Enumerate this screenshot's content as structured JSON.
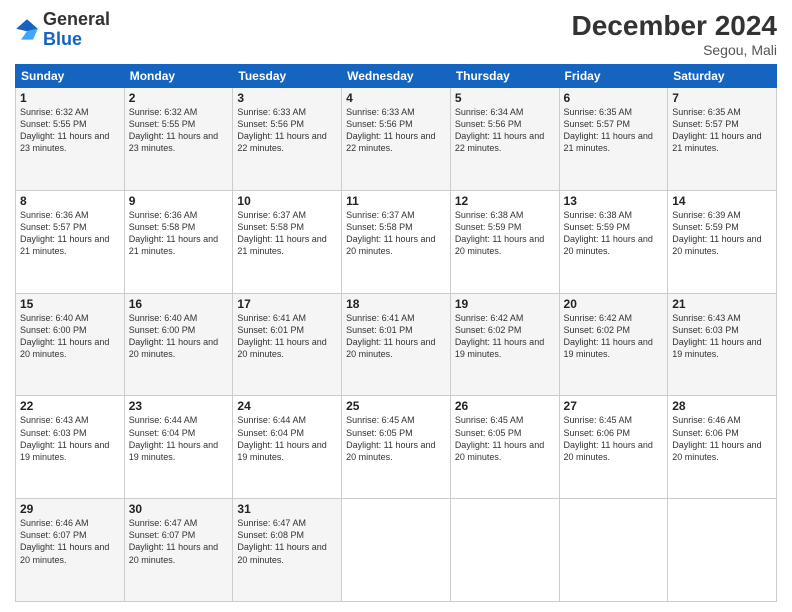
{
  "logo": {
    "text_general": "General",
    "text_blue": "Blue"
  },
  "header": {
    "month": "December 2024",
    "location": "Segou, Mali"
  },
  "weekdays": [
    "Sunday",
    "Monday",
    "Tuesday",
    "Wednesday",
    "Thursday",
    "Friday",
    "Saturday"
  ],
  "weeks": [
    [
      {
        "day": "1",
        "sunrise": "6:32 AM",
        "sunset": "5:55 PM",
        "daylight": "11 hours and 23 minutes."
      },
      {
        "day": "2",
        "sunrise": "6:32 AM",
        "sunset": "5:55 PM",
        "daylight": "11 hours and 23 minutes."
      },
      {
        "day": "3",
        "sunrise": "6:33 AM",
        "sunset": "5:56 PM",
        "daylight": "11 hours and 22 minutes."
      },
      {
        "day": "4",
        "sunrise": "6:33 AM",
        "sunset": "5:56 PM",
        "daylight": "11 hours and 22 minutes."
      },
      {
        "day": "5",
        "sunrise": "6:34 AM",
        "sunset": "5:56 PM",
        "daylight": "11 hours and 22 minutes."
      },
      {
        "day": "6",
        "sunrise": "6:35 AM",
        "sunset": "5:57 PM",
        "daylight": "11 hours and 21 minutes."
      },
      {
        "day": "7",
        "sunrise": "6:35 AM",
        "sunset": "5:57 PM",
        "daylight": "11 hours and 21 minutes."
      }
    ],
    [
      {
        "day": "8",
        "sunrise": "6:36 AM",
        "sunset": "5:57 PM",
        "daylight": "11 hours and 21 minutes."
      },
      {
        "day": "9",
        "sunrise": "6:36 AM",
        "sunset": "5:58 PM",
        "daylight": "11 hours and 21 minutes."
      },
      {
        "day": "10",
        "sunrise": "6:37 AM",
        "sunset": "5:58 PM",
        "daylight": "11 hours and 21 minutes."
      },
      {
        "day": "11",
        "sunrise": "6:37 AM",
        "sunset": "5:58 PM",
        "daylight": "11 hours and 20 minutes."
      },
      {
        "day": "12",
        "sunrise": "6:38 AM",
        "sunset": "5:59 PM",
        "daylight": "11 hours and 20 minutes."
      },
      {
        "day": "13",
        "sunrise": "6:38 AM",
        "sunset": "5:59 PM",
        "daylight": "11 hours and 20 minutes."
      },
      {
        "day": "14",
        "sunrise": "6:39 AM",
        "sunset": "5:59 PM",
        "daylight": "11 hours and 20 minutes."
      }
    ],
    [
      {
        "day": "15",
        "sunrise": "6:40 AM",
        "sunset": "6:00 PM",
        "daylight": "11 hours and 20 minutes."
      },
      {
        "day": "16",
        "sunrise": "6:40 AM",
        "sunset": "6:00 PM",
        "daylight": "11 hours and 20 minutes."
      },
      {
        "day": "17",
        "sunrise": "6:41 AM",
        "sunset": "6:01 PM",
        "daylight": "11 hours and 20 minutes."
      },
      {
        "day": "18",
        "sunrise": "6:41 AM",
        "sunset": "6:01 PM",
        "daylight": "11 hours and 20 minutes."
      },
      {
        "day": "19",
        "sunrise": "6:42 AM",
        "sunset": "6:02 PM",
        "daylight": "11 hours and 19 minutes."
      },
      {
        "day": "20",
        "sunrise": "6:42 AM",
        "sunset": "6:02 PM",
        "daylight": "11 hours and 19 minutes."
      },
      {
        "day": "21",
        "sunrise": "6:43 AM",
        "sunset": "6:03 PM",
        "daylight": "11 hours and 19 minutes."
      }
    ],
    [
      {
        "day": "22",
        "sunrise": "6:43 AM",
        "sunset": "6:03 PM",
        "daylight": "11 hours and 19 minutes."
      },
      {
        "day": "23",
        "sunrise": "6:44 AM",
        "sunset": "6:04 PM",
        "daylight": "11 hours and 19 minutes."
      },
      {
        "day": "24",
        "sunrise": "6:44 AM",
        "sunset": "6:04 PM",
        "daylight": "11 hours and 19 minutes."
      },
      {
        "day": "25",
        "sunrise": "6:45 AM",
        "sunset": "6:05 PM",
        "daylight": "11 hours and 20 minutes."
      },
      {
        "day": "26",
        "sunrise": "6:45 AM",
        "sunset": "6:05 PM",
        "daylight": "11 hours and 20 minutes."
      },
      {
        "day": "27",
        "sunrise": "6:45 AM",
        "sunset": "6:06 PM",
        "daylight": "11 hours and 20 minutes."
      },
      {
        "day": "28",
        "sunrise": "6:46 AM",
        "sunset": "6:06 PM",
        "daylight": "11 hours and 20 minutes."
      }
    ],
    [
      {
        "day": "29",
        "sunrise": "6:46 AM",
        "sunset": "6:07 PM",
        "daylight": "11 hours and 20 minutes."
      },
      {
        "day": "30",
        "sunrise": "6:47 AM",
        "sunset": "6:07 PM",
        "daylight": "11 hours and 20 minutes."
      },
      {
        "day": "31",
        "sunrise": "6:47 AM",
        "sunset": "6:08 PM",
        "daylight": "11 hours and 20 minutes."
      },
      null,
      null,
      null,
      null
    ]
  ]
}
